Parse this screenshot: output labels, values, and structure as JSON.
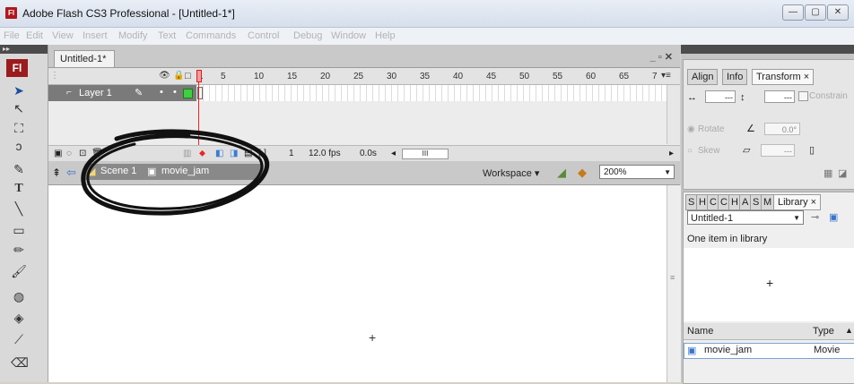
{
  "window": {
    "title": "Adobe Flash CS3 Professional - [Untitled-1*]",
    "app_icon_label": "Fl",
    "controls": [
      "—",
      "▢",
      "✕"
    ]
  },
  "menu": {
    "items": [
      "File",
      "Edit",
      "View",
      "Insert",
      "Modify",
      "Text",
      "Commands",
      "Control",
      "Debug",
      "Window",
      "Help"
    ]
  },
  "tools": {
    "logo": "Fl",
    "items": [
      {
        "icon": "selection-arrow-icon",
        "glyph": "➤"
      },
      {
        "icon": "subselection-arrow-icon",
        "glyph": "↖"
      },
      {
        "icon": "free-transform-icon",
        "glyph": "⛶"
      },
      {
        "icon": "lasso-icon",
        "glyph": "ɔ"
      },
      {
        "icon": "pen-icon",
        "glyph": "✎"
      },
      {
        "icon": "text-tool-icon",
        "glyph": "T"
      },
      {
        "icon": "line-tool-icon",
        "glyph": "╲"
      },
      {
        "icon": "rectangle-tool-icon",
        "glyph": "▭"
      },
      {
        "icon": "pencil-icon",
        "glyph": "✏"
      },
      {
        "icon": "brush-icon",
        "glyph": "🖌"
      },
      {
        "icon": "ink-bottle-icon",
        "glyph": "◍"
      },
      {
        "icon": "paint-bucket-icon",
        "glyph": "◈"
      },
      {
        "icon": "eyedropper-icon",
        "glyph": "⟋"
      },
      {
        "icon": "eraser-icon",
        "glyph": "⌫"
      }
    ]
  },
  "document": {
    "tab_label": "Untitled-1*",
    "window_controls": "_ ▫ ✕"
  },
  "timeline": {
    "frame_numbers": [
      "1",
      "5",
      "10",
      "15",
      "20",
      "25",
      "30",
      "35",
      "40",
      "45",
      "50",
      "55",
      "60",
      "65",
      "7"
    ],
    "layer_name": "Layer 1",
    "current_frame": "1",
    "frame_rate": "12.0 fps",
    "elapsed_time": "0.0s"
  },
  "editbar": {
    "scene": "Scene 1",
    "symbol": "movie_jam",
    "workspace_label": "Workspace ▾",
    "zoom": "200%"
  },
  "stage": {
    "crosshair": "+"
  },
  "transform_panel": {
    "tabs": [
      "Align",
      "Info",
      "Transform ×"
    ],
    "width_value": "---",
    "height_value": "---",
    "constrain_label": "Constrain",
    "rotate_label": "Rotate",
    "rotate_value": "0.0°",
    "skew_label": "Skew",
    "skew_value": "---"
  },
  "library_panel": {
    "tabs": [
      "S",
      "H",
      "C",
      "C",
      "H",
      "A",
      "S",
      "M",
      "Library ×"
    ],
    "document_select": "Untitled-1",
    "item_count_text": "One item in library",
    "preview_crosshair": "+",
    "column_name": "Name",
    "column_type": "Type",
    "items": [
      {
        "name": "movie_jam",
        "type": "Movie"
      }
    ]
  },
  "colors": {
    "playhead": "#e22222",
    "flash_brand": "#9b1b1e",
    "annotation_ink": "#111111"
  }
}
